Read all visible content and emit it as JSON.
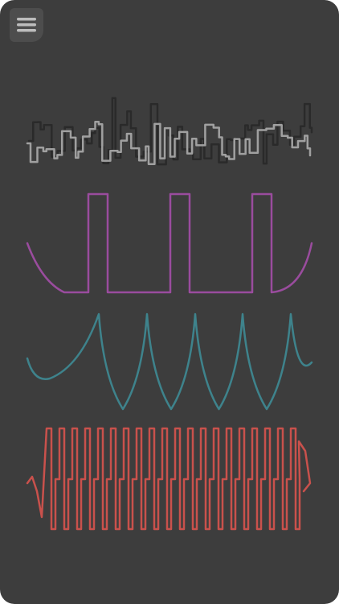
{
  "colors": {
    "background": "#3d3d3d",
    "menu_button": "#4d4d4d",
    "menu_icon": "#bdbdbd"
  },
  "menu": {
    "icon": "hamburger-menu-icon"
  },
  "waveforms": [
    {
      "id": "noise",
      "type": "noise",
      "stroke": "#a0a0a0",
      "shadow_stroke": "#2a2a2a"
    },
    {
      "id": "pulse",
      "type": "pulse",
      "stroke": "#9a4c9e"
    },
    {
      "id": "arch",
      "type": "arch",
      "stroke": "#3e838c"
    },
    {
      "id": "square",
      "type": "square",
      "stroke": "#c9514c"
    }
  ]
}
